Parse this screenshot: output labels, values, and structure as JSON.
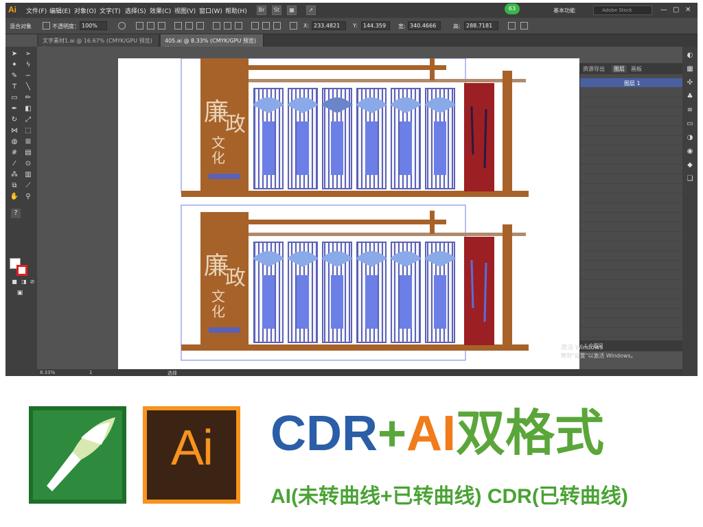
{
  "app": {
    "logo": "Ai",
    "menu": [
      "文件(F)",
      "编辑(E)",
      "对象(O)",
      "文字(T)",
      "选择(S)",
      "效果(C)",
      "视图(V)",
      "窗口(W)",
      "帮助(H)"
    ],
    "badge": "63",
    "workspace": "基本功能",
    "stock_search": "Adobe Stock",
    "window_buttons": [
      "—",
      "▢",
      "✕"
    ]
  },
  "control_bar": {
    "object_label": "混合对象",
    "opacity_label": "不透明度：",
    "opacity_value": "100%",
    "x_label": "X:",
    "x_value": "233.4821",
    "y_label": "Y:",
    "y_value": "144.359",
    "w_label": "宽:",
    "w_value": "340.4666",
    "h_label": "高:",
    "h_value": "288.7181"
  },
  "tabs": [
    {
      "label": "文字素材1.ai @ 16.67% (CMYK/GPU 预览)",
      "close": "×"
    },
    {
      "label": "405.ai @ 8.33% (CMYK/GPU 预览)",
      "close": "×"
    }
  ],
  "status_bar": {
    "zoom": "8.33%",
    "page": "1",
    "selection": "选择"
  },
  "layers_panel": {
    "tabs": [
      "资源导出",
      "图层",
      "画板"
    ],
    "top_layer": "图层 1",
    "count_label": "1 个图层"
  },
  "watermark": {
    "line1": "激活 Windows",
    "line2": "转到\"设置\"以激活 Windows。"
  },
  "artwork": {
    "title_chars": [
      "廉",
      "政"
    ],
    "subtitle_chars": [
      "文",
      "化"
    ],
    "colors": {
      "board_brown": "#a7622a",
      "board_red": "#9c1f24",
      "panel_frame": "#5a61b6",
      "panel_blue": "#6b7fe6"
    }
  },
  "promo": {
    "ai_logo": "Ai",
    "headline_cdr": "CDR",
    "headline_plus": "+",
    "headline_ai": "AI",
    "headline_cn": "双格式",
    "subline": "AI(未转曲线+已转曲线) CDR(已转曲线)"
  }
}
